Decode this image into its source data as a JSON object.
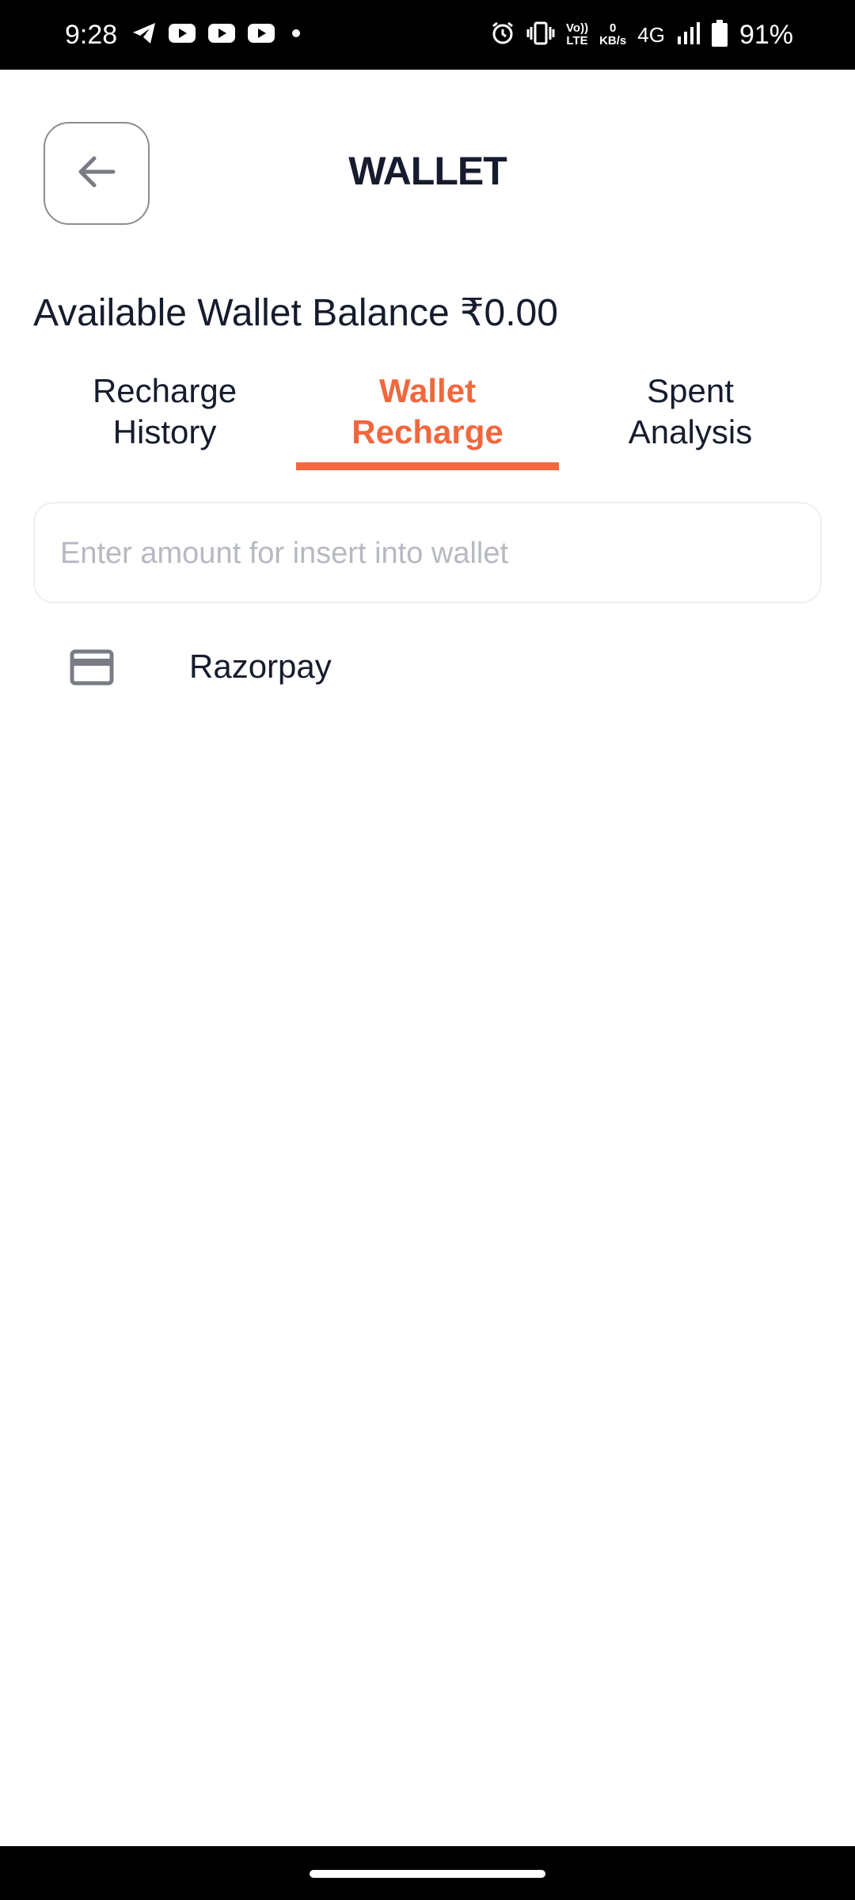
{
  "status_bar": {
    "time": "9:28",
    "left_icons": [
      "telegram-icon",
      "youtube-icon",
      "youtube-icon",
      "youtube-icon",
      "dot-icon"
    ],
    "right_icons": [
      "alarm-icon",
      "vibrate-icon",
      "volte-icon",
      "net-speed",
      "network-type",
      "signal-icon",
      "battery-icon"
    ],
    "volte_top": "Vo))",
    "volte_bottom": "LTE",
    "speed_value": "0",
    "speed_unit": "KB/s",
    "network": "4G",
    "battery": "91%"
  },
  "header": {
    "title": "WALLET",
    "back_icon": "arrow-left-icon"
  },
  "balance": {
    "text": "Available Wallet Balance ₹0.00"
  },
  "tabs": [
    {
      "line1": "Recharge",
      "line2": "History",
      "active": false
    },
    {
      "line1": "Wallet",
      "line2": "Recharge",
      "active": true
    },
    {
      "line1": "Spent",
      "line2": "Analysis",
      "active": false
    }
  ],
  "amount_input": {
    "value": "",
    "placeholder": "Enter amount for insert into wallet"
  },
  "payment_methods": [
    {
      "icon": "credit-card-icon",
      "label": "Razorpay"
    }
  ],
  "colors": {
    "accent": "#f2673d",
    "text_primary": "#161c2d",
    "placeholder": "#b6b9c1",
    "border": "#efeff2",
    "icon_gray": "#7a7c84"
  }
}
